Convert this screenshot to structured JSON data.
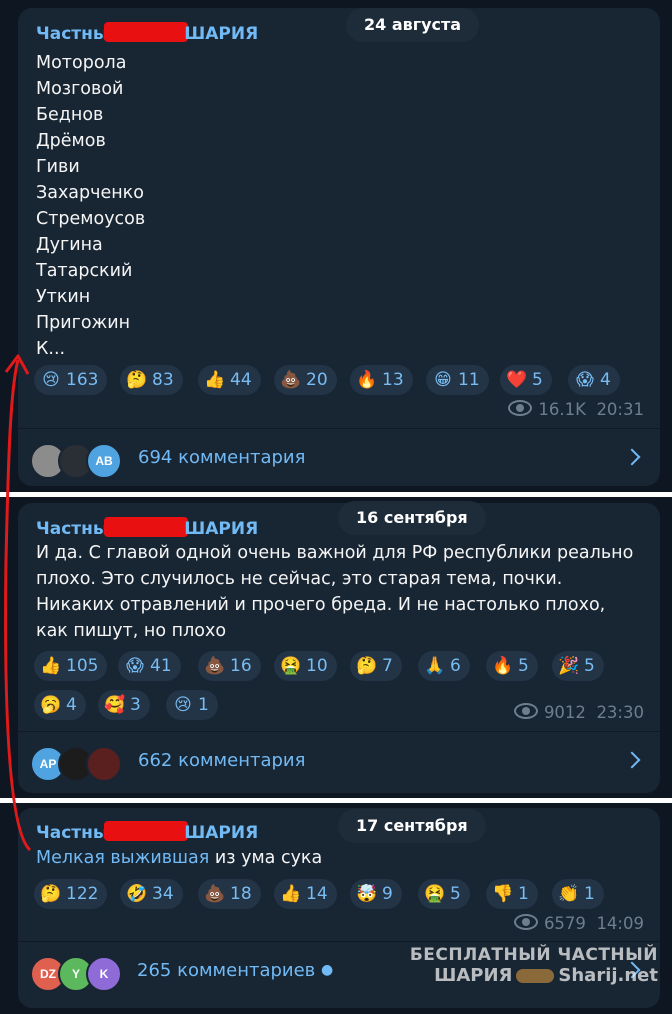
{
  "posts": [
    {
      "sender_prefix": "Частны",
      "sender_suffix": "ШАРИЯ",
      "date": "24 августа",
      "names": [
        "Моторола",
        "Мозговой",
        "Беднов",
        "Дрёмов",
        "Гиви",
        "Захарченко",
        "Стремоусов",
        "Дугина",
        "Татарский",
        "Уткин",
        "Пригожин",
        "К..."
      ],
      "reactions": [
        {
          "emoji": "😢",
          "count": "163"
        },
        {
          "emoji": "🤔",
          "count": "83"
        },
        {
          "emoji": "👍",
          "count": "44"
        },
        {
          "emoji": "💩",
          "count": "20"
        },
        {
          "emoji": "🔥",
          "count": "13"
        },
        {
          "emoji": "😁",
          "count": "11"
        },
        {
          "emoji": "❤️",
          "count": "5"
        },
        {
          "emoji": "😱",
          "count": "4"
        }
      ],
      "views": "16.1K",
      "time": "20:31",
      "avatars": [
        {
          "label": "",
          "color": "#8c8c8c"
        },
        {
          "label": "",
          "color": "#2a2f36"
        },
        {
          "label": "AB",
          "color": "#4fa3e0"
        }
      ],
      "comments": "694 комментария"
    },
    {
      "sender_prefix": "Частны",
      "sender_suffix": "ШАРИЯ",
      "date": "16 сентября",
      "text": [
        "И да. С главой одной очень важной для РФ республики реально",
        "плохо. Это случилось не сейчас, это старая тема, почки.",
        "Никаких отравлений и прочего бреда. И не настолько плохо,",
        "как пишут, но плохо"
      ],
      "reactions": [
        {
          "emoji": "👍",
          "count": "105"
        },
        {
          "emoji": "😱",
          "count": "41"
        },
        {
          "emoji": "💩",
          "count": "16"
        },
        {
          "emoji": "🤮",
          "count": "10"
        },
        {
          "emoji": "🤔",
          "count": "7"
        },
        {
          "emoji": "🙏",
          "count": "6"
        },
        {
          "emoji": "🔥",
          "count": "5"
        },
        {
          "emoji": "🎉",
          "count": "5"
        },
        {
          "emoji": "🥱",
          "count": "4"
        },
        {
          "emoji": "🥰",
          "count": "3"
        },
        {
          "emoji": "😢",
          "count": "1"
        }
      ],
      "views": "9012",
      "time": "23:30",
      "avatars": [
        {
          "label": "AP",
          "color": "#4fa3e0"
        },
        {
          "label": "",
          "color": "#1c1c1c"
        },
        {
          "label": "",
          "color": "#5a2020"
        }
      ],
      "comments": "662 комментария"
    },
    {
      "sender_prefix": "Частны",
      "sender_suffix": "ШАРИЯ",
      "date": "17 сентября",
      "link_text": "Мелкая выжившая",
      "rest_text": " из ума сука",
      "reactions": [
        {
          "emoji": "🤔",
          "count": "122"
        },
        {
          "emoji": "🤣",
          "count": "34"
        },
        {
          "emoji": "💩",
          "count": "18"
        },
        {
          "emoji": "👍",
          "count": "14"
        },
        {
          "emoji": "🤯",
          "count": "9"
        },
        {
          "emoji": "🤮",
          "count": "5"
        },
        {
          "emoji": "👎",
          "count": "1"
        },
        {
          "emoji": "👏",
          "count": "1"
        }
      ],
      "views": "6579",
      "time": "14:09",
      "avatars": [
        {
          "label": "DZ",
          "color": "#e0604f"
        },
        {
          "label": "Y",
          "color": "#5cb85c"
        },
        {
          "label": "K",
          "color": "#8e6bd6"
        }
      ],
      "comments": "265 комментариев"
    }
  ],
  "watermark": {
    "line1": "БЕСПЛАТНЫЙ ЧАСТНЫЙ",
    "line2a": "ШАРИЯ",
    "line2b": "Sharij.net"
  },
  "colors": {
    "background": "#0e1621",
    "bubble": "#182533",
    "accent": "#71baf5",
    "arrow": "#e01a1a"
  }
}
